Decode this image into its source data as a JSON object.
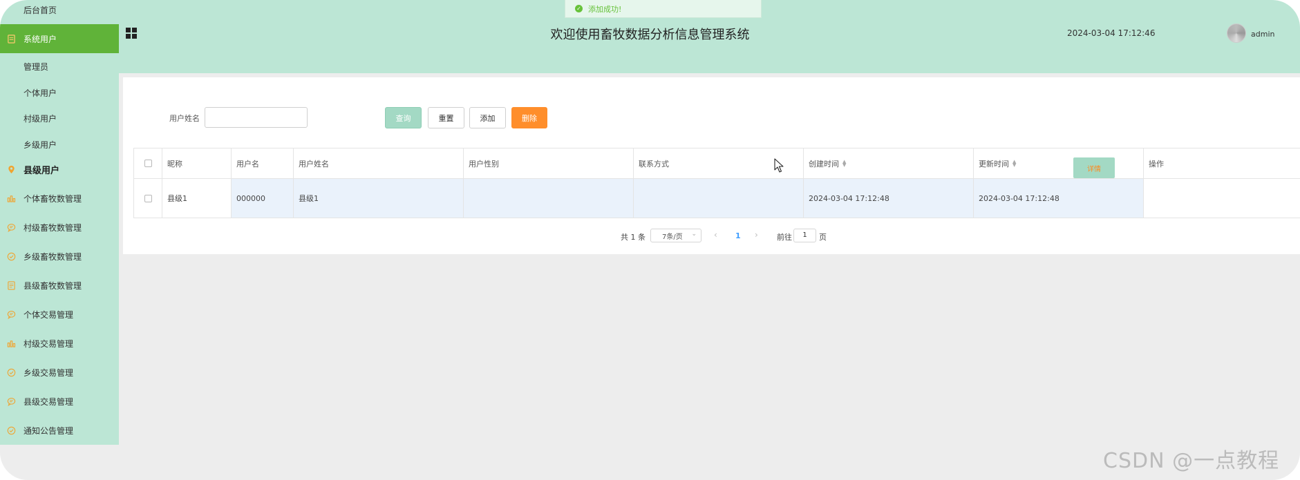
{
  "toast": {
    "message": "添加成功!"
  },
  "header": {
    "title": "欢迎使用畜牧数据分析信息管理系统",
    "datetime": "2024-03-04 17:12:46",
    "user": "admin"
  },
  "sidebar": {
    "items": [
      {
        "label": "后台首页",
        "icon": "none"
      },
      {
        "label": "系统用户",
        "icon": "document-icon",
        "active": true
      },
      {
        "label": "管理员",
        "sub": true
      },
      {
        "label": "个体用户",
        "sub": true
      },
      {
        "label": "村级用户",
        "sub": true
      },
      {
        "label": "乡级用户",
        "sub": true
      },
      {
        "label": "县级用户",
        "icon": "location-pin-icon",
        "group": true
      },
      {
        "label": "个体畜牧数管理",
        "icon": "bar-chart-icon"
      },
      {
        "label": "村级畜牧数管理",
        "icon": "chat-bubble-icon"
      },
      {
        "label": "乡级畜牧数管理",
        "icon": "check-circle-icon"
      },
      {
        "label": "县级畜牧数管理",
        "icon": "document-icon"
      },
      {
        "label": "个体交易管理",
        "icon": "chat-bubble-icon"
      },
      {
        "label": "村级交易管理",
        "icon": "bar-chart-icon"
      },
      {
        "label": "乡级交易管理",
        "icon": "check-circle-icon"
      },
      {
        "label": "县级交易管理",
        "icon": "chat-bubble-icon"
      },
      {
        "label": "通知公告管理",
        "icon": "check-circle-icon"
      }
    ]
  },
  "search": {
    "label": "用户姓名",
    "value": "",
    "query_label": "查询",
    "reset_label": "重置",
    "add_label": "添加",
    "delete_label": "删除"
  },
  "table": {
    "columns": [
      "昵称",
      "用户名",
      "用户姓名",
      "用户性别",
      "联系方式",
      "创建时间",
      "更新时间",
      "操作"
    ],
    "rows": [
      {
        "nickname": "县级1",
        "username": "000000",
        "realname": "县级1",
        "gender": "",
        "contact": "",
        "created": "2024-03-04 17:12:48",
        "updated": "2024-03-04 17:12:48",
        "action": "详情"
      }
    ]
  },
  "pagination": {
    "total_text": "共 1 条",
    "page_size": "7条/页",
    "current_page": "1",
    "goto_label": "前往",
    "goto_value": "1",
    "page_suffix": "页"
  },
  "watermark": "CSDN @一点教程",
  "colors": {
    "sidebar_bg": "#bce6d5",
    "active_bg": "#60b339",
    "query_button": "#a3d9c4",
    "delete_button": "#ff8e2b",
    "row_highlight": "#eaf2fb"
  }
}
